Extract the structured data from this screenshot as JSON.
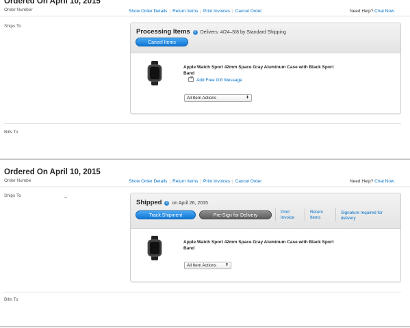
{
  "orders": [
    {
      "title": "Ordered On April 10, 2015",
      "order_number_label": "Order Number",
      "links": [
        "Show Order Details",
        "Return Items",
        "Print Invoices",
        "Cancel Order"
      ],
      "help_text": "Need Help?",
      "help_link": "Chat Now",
      "ships_to_label": "Ships To",
      "bills_to_label": "Bills To",
      "status": "Processing Items",
      "status_detail": "Delivers: 4/24–5/8 by Standard Shipping",
      "primary_button": "Cancel Items",
      "item_title": "Apple Watch Sport 42mm Space Gray Aluminum Case with Black Sport Band",
      "gift_link": "Add Free Gift Message",
      "item_actions": "All Item Actions"
    },
    {
      "title": "Ordered On April 10, 2015",
      "order_number_label": "Order Numbe",
      "links": [
        "Show Order Details",
        "Return Items",
        "Print Invoices",
        "Cancel Order"
      ],
      "help_text": "Need Help?",
      "help_link": "Chat Now",
      "ships_to_label": "Ships To",
      "bills_to_label": "Bills To",
      "status": "Shipped",
      "status_detail": "on April 26, 2015",
      "primary_button": "Track Shipment",
      "secondary_button": "Pre-Sign for Delivery",
      "head_links": [
        {
          "line1": "Print",
          "line2": "Invoice"
        },
        {
          "line1": "Return",
          "line2": "Items"
        },
        {
          "line1": "Signature required for",
          "line2": "delivery"
        }
      ],
      "item_title": "Apple Watch Sport 42mm Space Gray Aluminum Case with Black Sport Band",
      "item_actions": "All Item Actions"
    }
  ],
  "colors": {
    "link": "#0070c9",
    "button_blue": "#1278d4",
    "button_gray": "#5c5c5c"
  },
  "icons": [
    "info-icon",
    "watch-image",
    "gift-icon",
    "select-arrows-icon"
  ]
}
